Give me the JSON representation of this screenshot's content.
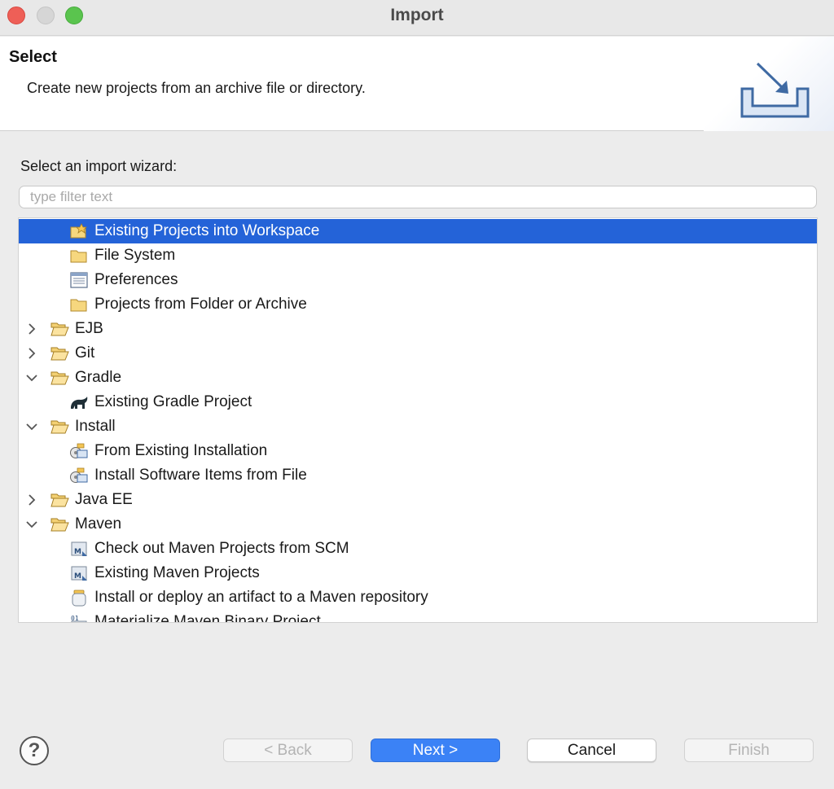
{
  "window": {
    "title": "Import"
  },
  "header": {
    "title": "Select",
    "description": "Create new projects from an archive file or directory."
  },
  "body": {
    "prompt": "Select an import wizard:",
    "filter_placeholder": "type filter text",
    "filter_value": ""
  },
  "tree": {
    "rows": [
      {
        "label": "Existing Projects into Workspace",
        "level": 1,
        "icon": "project-import-icon",
        "selected": true
      },
      {
        "label": "File System",
        "level": 1,
        "icon": "folder-icon"
      },
      {
        "label": "Preferences",
        "level": 1,
        "icon": "preferences-icon"
      },
      {
        "label": "Projects from Folder or Archive",
        "level": 1,
        "icon": "folder-icon"
      },
      {
        "label": "EJB",
        "level": 0,
        "icon": "open-folder-icon",
        "expanded": false
      },
      {
        "label": "Git",
        "level": 0,
        "icon": "open-folder-icon",
        "expanded": false
      },
      {
        "label": "Gradle",
        "level": 0,
        "icon": "open-folder-icon",
        "expanded": true
      },
      {
        "label": "Existing Gradle Project",
        "level": 1,
        "icon": "gradle-icon"
      },
      {
        "label": "Install",
        "level": 0,
        "icon": "open-folder-icon",
        "expanded": true
      },
      {
        "label": "From Existing Installation",
        "level": 1,
        "icon": "install-icon"
      },
      {
        "label": "Install Software Items from File",
        "level": 1,
        "icon": "install-icon"
      },
      {
        "label": "Java EE",
        "level": 0,
        "icon": "open-folder-icon",
        "expanded": false
      },
      {
        "label": "Maven",
        "level": 0,
        "icon": "open-folder-icon",
        "expanded": true
      },
      {
        "label": "Check out Maven Projects from SCM",
        "level": 1,
        "icon": "maven-icon"
      },
      {
        "label": "Existing Maven Projects",
        "level": 1,
        "icon": "maven-icon"
      },
      {
        "label": "Install or deploy an artifact to a Maven repository",
        "level": 1,
        "icon": "jar-icon"
      },
      {
        "label": "Materialize Maven Binary Project",
        "level": 1,
        "icon": "maven-binary-icon"
      }
    ]
  },
  "footer": {
    "help_label": "?",
    "back_label": "< Back",
    "next_label": "Next >",
    "cancel_label": "Cancel",
    "finish_label": "Finish"
  },
  "colors": {
    "selection": "#2463d8",
    "default_button": "#3b82f6"
  }
}
